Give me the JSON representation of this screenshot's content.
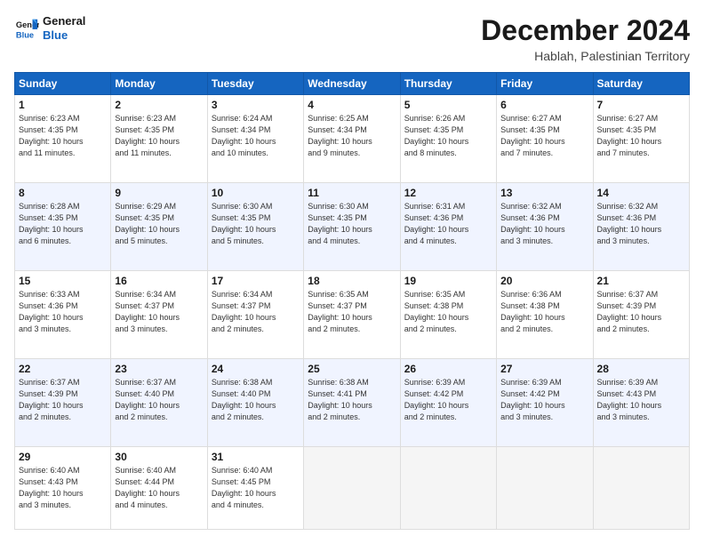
{
  "logo": {
    "line1": "General",
    "line2": "Blue"
  },
  "title": "December 2024",
  "location": "Hablah, Palestinian Territory",
  "days_of_week": [
    "Sunday",
    "Monday",
    "Tuesday",
    "Wednesday",
    "Thursday",
    "Friday",
    "Saturday"
  ],
  "weeks": [
    [
      {
        "num": "1",
        "info": "Sunrise: 6:23 AM\nSunset: 4:35 PM\nDaylight: 10 hours\nand 11 minutes."
      },
      {
        "num": "2",
        "info": "Sunrise: 6:23 AM\nSunset: 4:35 PM\nDaylight: 10 hours\nand 11 minutes."
      },
      {
        "num": "3",
        "info": "Sunrise: 6:24 AM\nSunset: 4:34 PM\nDaylight: 10 hours\nand 10 minutes."
      },
      {
        "num": "4",
        "info": "Sunrise: 6:25 AM\nSunset: 4:34 PM\nDaylight: 10 hours\nand 9 minutes."
      },
      {
        "num": "5",
        "info": "Sunrise: 6:26 AM\nSunset: 4:35 PM\nDaylight: 10 hours\nand 8 minutes."
      },
      {
        "num": "6",
        "info": "Sunrise: 6:27 AM\nSunset: 4:35 PM\nDaylight: 10 hours\nand 7 minutes."
      },
      {
        "num": "7",
        "info": "Sunrise: 6:27 AM\nSunset: 4:35 PM\nDaylight: 10 hours\nand 7 minutes."
      }
    ],
    [
      {
        "num": "8",
        "info": "Sunrise: 6:28 AM\nSunset: 4:35 PM\nDaylight: 10 hours\nand 6 minutes."
      },
      {
        "num": "9",
        "info": "Sunrise: 6:29 AM\nSunset: 4:35 PM\nDaylight: 10 hours\nand 5 minutes."
      },
      {
        "num": "10",
        "info": "Sunrise: 6:30 AM\nSunset: 4:35 PM\nDaylight: 10 hours\nand 5 minutes."
      },
      {
        "num": "11",
        "info": "Sunrise: 6:30 AM\nSunset: 4:35 PM\nDaylight: 10 hours\nand 4 minutes."
      },
      {
        "num": "12",
        "info": "Sunrise: 6:31 AM\nSunset: 4:36 PM\nDaylight: 10 hours\nand 4 minutes."
      },
      {
        "num": "13",
        "info": "Sunrise: 6:32 AM\nSunset: 4:36 PM\nDaylight: 10 hours\nand 3 minutes."
      },
      {
        "num": "14",
        "info": "Sunrise: 6:32 AM\nSunset: 4:36 PM\nDaylight: 10 hours\nand 3 minutes."
      }
    ],
    [
      {
        "num": "15",
        "info": "Sunrise: 6:33 AM\nSunset: 4:36 PM\nDaylight: 10 hours\nand 3 minutes."
      },
      {
        "num": "16",
        "info": "Sunrise: 6:34 AM\nSunset: 4:37 PM\nDaylight: 10 hours\nand 3 minutes."
      },
      {
        "num": "17",
        "info": "Sunrise: 6:34 AM\nSunset: 4:37 PM\nDaylight: 10 hours\nand 2 minutes."
      },
      {
        "num": "18",
        "info": "Sunrise: 6:35 AM\nSunset: 4:37 PM\nDaylight: 10 hours\nand 2 minutes."
      },
      {
        "num": "19",
        "info": "Sunrise: 6:35 AM\nSunset: 4:38 PM\nDaylight: 10 hours\nand 2 minutes."
      },
      {
        "num": "20",
        "info": "Sunrise: 6:36 AM\nSunset: 4:38 PM\nDaylight: 10 hours\nand 2 minutes."
      },
      {
        "num": "21",
        "info": "Sunrise: 6:37 AM\nSunset: 4:39 PM\nDaylight: 10 hours\nand 2 minutes."
      }
    ],
    [
      {
        "num": "22",
        "info": "Sunrise: 6:37 AM\nSunset: 4:39 PM\nDaylight: 10 hours\nand 2 minutes."
      },
      {
        "num": "23",
        "info": "Sunrise: 6:37 AM\nSunset: 4:40 PM\nDaylight: 10 hours\nand 2 minutes."
      },
      {
        "num": "24",
        "info": "Sunrise: 6:38 AM\nSunset: 4:40 PM\nDaylight: 10 hours\nand 2 minutes."
      },
      {
        "num": "25",
        "info": "Sunrise: 6:38 AM\nSunset: 4:41 PM\nDaylight: 10 hours\nand 2 minutes."
      },
      {
        "num": "26",
        "info": "Sunrise: 6:39 AM\nSunset: 4:42 PM\nDaylight: 10 hours\nand 2 minutes."
      },
      {
        "num": "27",
        "info": "Sunrise: 6:39 AM\nSunset: 4:42 PM\nDaylight: 10 hours\nand 3 minutes."
      },
      {
        "num": "28",
        "info": "Sunrise: 6:39 AM\nSunset: 4:43 PM\nDaylight: 10 hours\nand 3 minutes."
      }
    ],
    [
      {
        "num": "29",
        "info": "Sunrise: 6:40 AM\nSunset: 4:43 PM\nDaylight: 10 hours\nand 3 minutes."
      },
      {
        "num": "30",
        "info": "Sunrise: 6:40 AM\nSunset: 4:44 PM\nDaylight: 10 hours\nand 4 minutes."
      },
      {
        "num": "31",
        "info": "Sunrise: 6:40 AM\nSunset: 4:45 PM\nDaylight: 10 hours\nand 4 minutes."
      },
      null,
      null,
      null,
      null
    ]
  ]
}
